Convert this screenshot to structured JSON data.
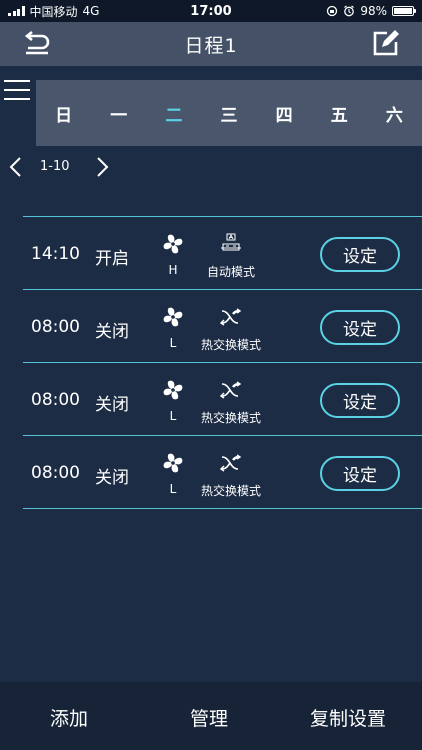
{
  "status_bar": {
    "carrier": "中国移动",
    "network": "4G",
    "time": "17:00",
    "battery": "98%",
    "battery_level": 0.98
  },
  "header": {
    "title": "日程1"
  },
  "days": [
    {
      "label": "日",
      "active": false
    },
    {
      "label": "一",
      "active": false
    },
    {
      "label": "二",
      "active": true
    },
    {
      "label": "三",
      "active": false
    },
    {
      "label": "四",
      "active": false
    },
    {
      "label": "五",
      "active": false
    },
    {
      "label": "六",
      "active": false
    }
  ],
  "pager": {
    "range": "1-10"
  },
  "schedule": [
    {
      "time": "14:10",
      "state": "开启",
      "fan": "H",
      "mode": "自动模式",
      "mode_icon": "auto-mode-icon",
      "button": "设定"
    },
    {
      "time": "08:00",
      "state": "关闭",
      "fan": "L",
      "mode": "热交换模式",
      "mode_icon": "heat-exchange-icon",
      "button": "设定"
    },
    {
      "time": "08:00",
      "state": "关闭",
      "fan": "L",
      "mode": "热交换模式",
      "mode_icon": "heat-exchange-icon",
      "button": "设定"
    },
    {
      "time": "08:00",
      "state": "关闭",
      "fan": "L",
      "mode": "热交换模式",
      "mode_icon": "heat-exchange-icon",
      "button": "设定"
    }
  ],
  "bottom": {
    "add": "添加",
    "manage": "管理",
    "copy": "复制设置"
  },
  "colors": {
    "accent": "#5ad2e4",
    "background": "#1d2c45",
    "header": "#455166",
    "tabs": "#4a566b"
  }
}
